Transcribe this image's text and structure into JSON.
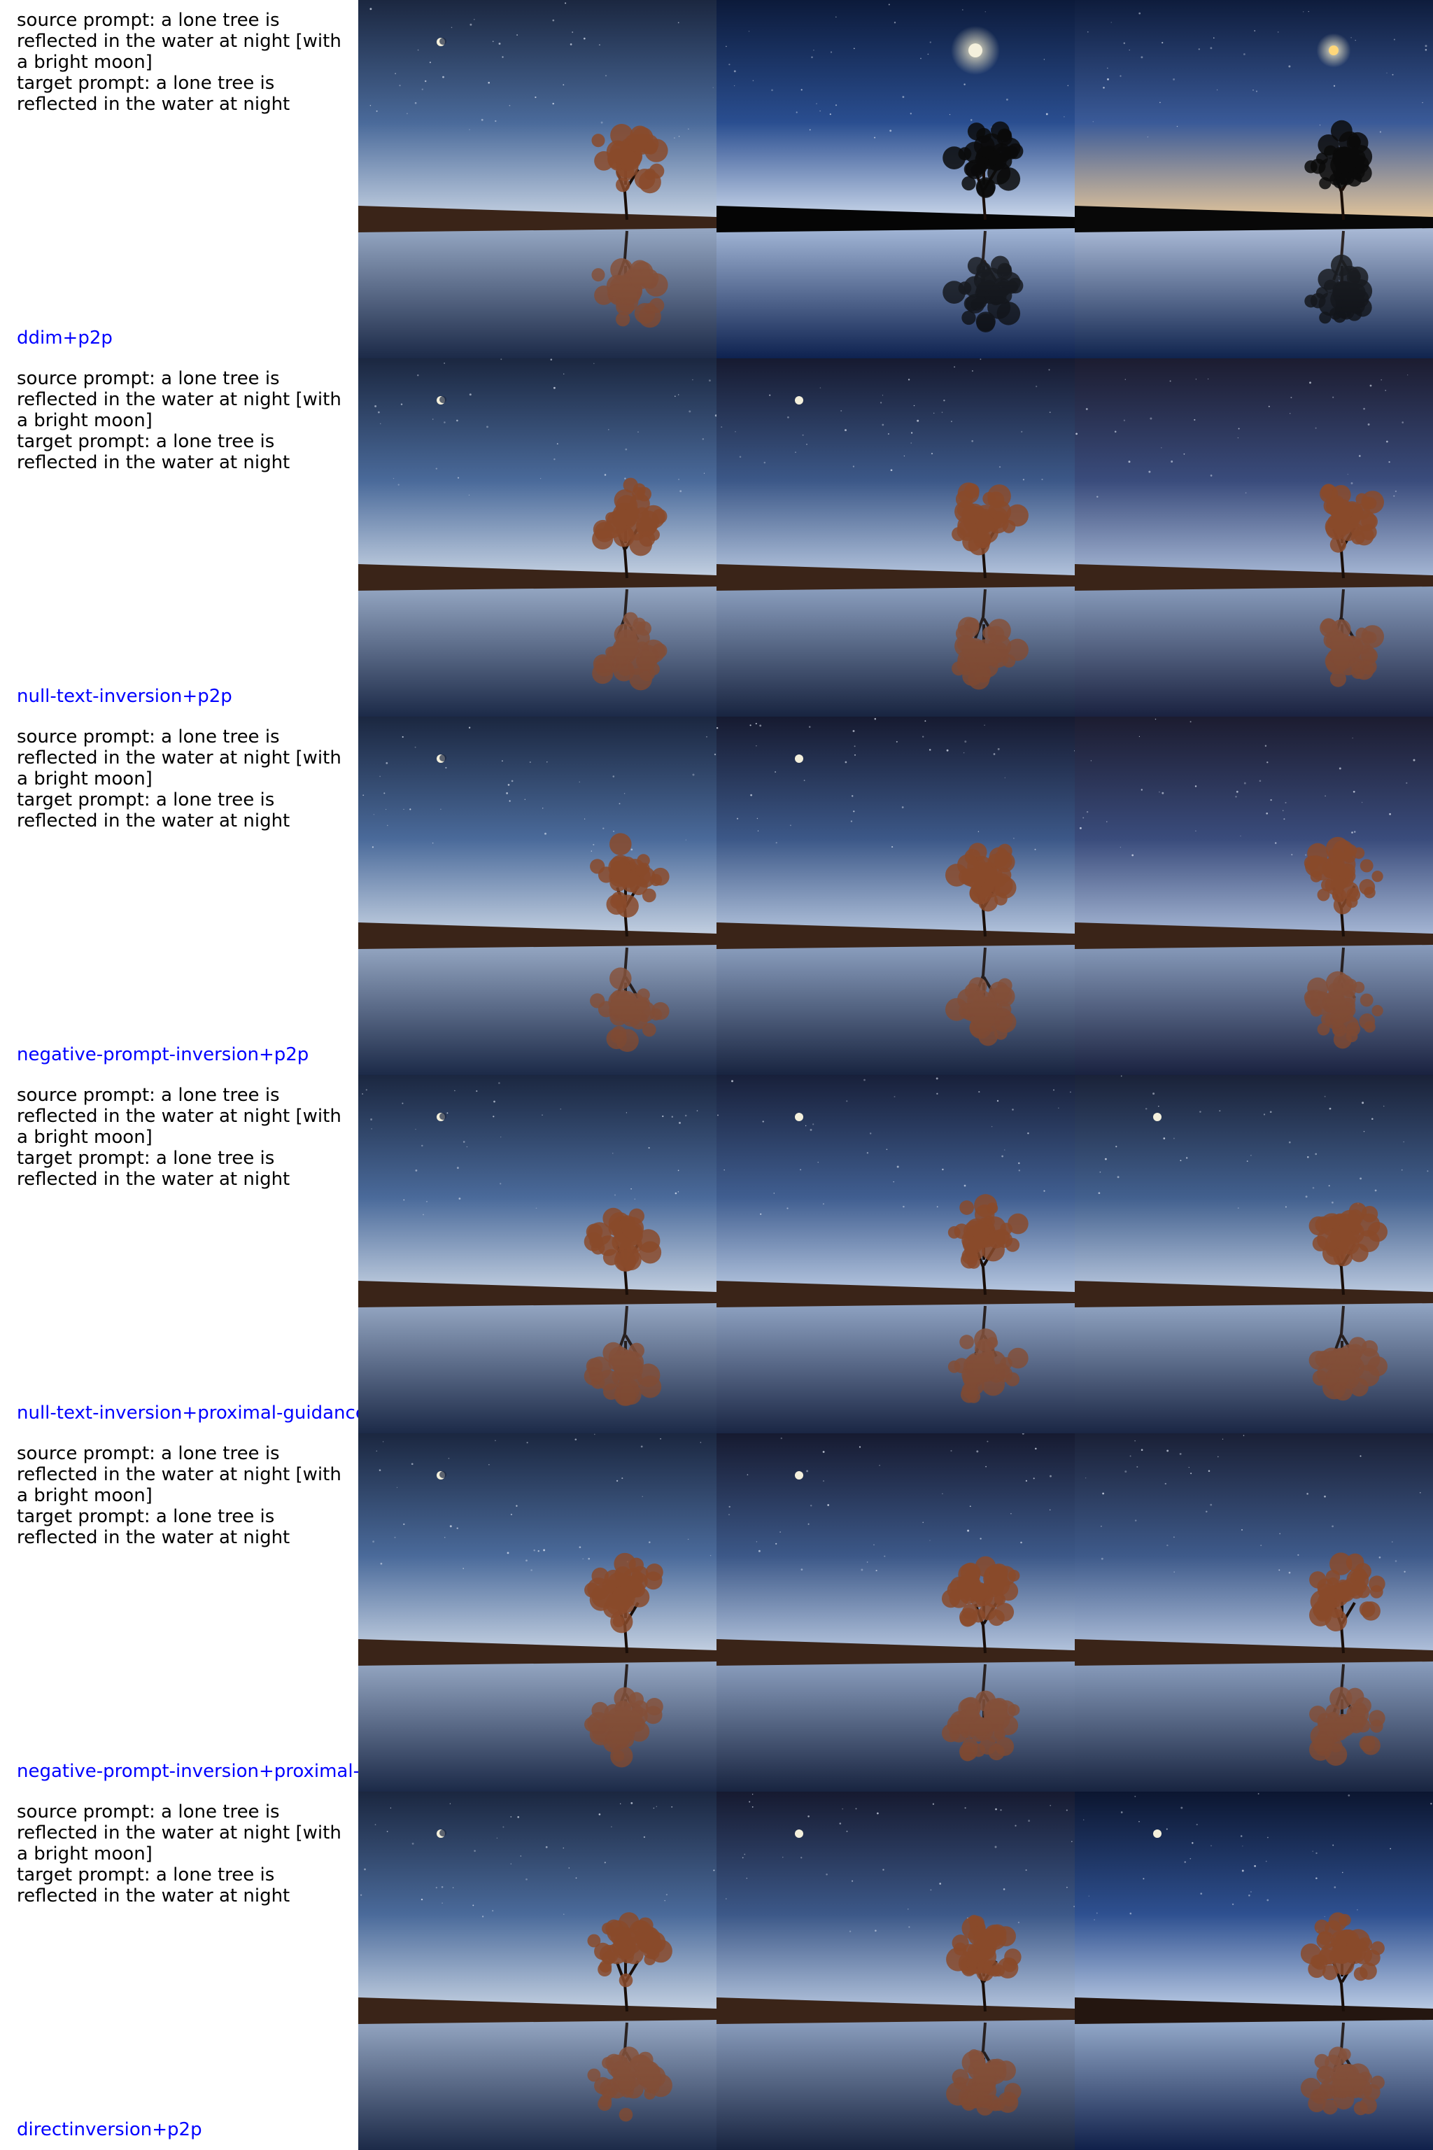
{
  "prompts": {
    "source_prefix": "source prompt: a lone tree is reflected in the water at night [with a bright moon]",
    "target_prefix": "target prompt: a lone tree is reflected in the water at night"
  },
  "rows": [
    {
      "method": "ddim+p2p",
      "images": [
        {
          "moon": "crescent",
          "moon_glow": false,
          "top": "#1b2740",
          "mid": "#4a6a9a",
          "horizon": "#c8d4e4",
          "tree": "#8a4a2a",
          "shore": "#3a2418",
          "water": "#9aacc8",
          "water_dark": "#1c2a48"
        },
        {
          "moon": "full",
          "moon_glow": true,
          "top": "#0c1a3a",
          "mid": "#2a4e90",
          "horizon": "#d0dcee",
          "tree": "#0a0a0a",
          "shore": "#050505",
          "water": "#a8bcdc",
          "water_dark": "#0e2250"
        },
        {
          "moon": "bright",
          "moon_glow": true,
          "top": "#0e1c3c",
          "mid": "#3a5a98",
          "horizon": "#e8c89a",
          "tree": "#0a0a0a",
          "shore": "#080808",
          "water": "#b0c0dc",
          "water_dark": "#10244e"
        }
      ]
    },
    {
      "method": "null-text-inversion+p2p",
      "images": [
        {
          "moon": "crescent",
          "moon_glow": false,
          "top": "#1b2740",
          "mid": "#4a6a9a",
          "horizon": "#c8d4e4",
          "tree": "#8a4a2a",
          "shore": "#3a2418",
          "water": "#9aacc8",
          "water_dark": "#1c2a48"
        },
        {
          "moon": "small",
          "moon_glow": false,
          "top": "#161a30",
          "mid": "#3c5888",
          "horizon": "#b8c8e0",
          "tree": "#8a4a2a",
          "shore": "#3a2418",
          "water": "#90a4c4",
          "water_dark": "#182440"
        },
        {
          "moon": "none",
          "moon_glow": false,
          "top": "#1c1c30",
          "mid": "#3a4c7c",
          "horizon": "#aabbd8",
          "tree": "#8a4a2a",
          "shore": "#3a2418",
          "water": "#8ca0c0",
          "water_dark": "#1a2240"
        }
      ]
    },
    {
      "method": "negative-prompt-inversion+p2p",
      "images": [
        {
          "moon": "crescent",
          "moon_glow": false,
          "top": "#1b2740",
          "mid": "#4a6a9a",
          "horizon": "#c8d4e4",
          "tree": "#8a4a2a",
          "shore": "#3a2418",
          "water": "#9aacc8",
          "water_dark": "#1c2a48"
        },
        {
          "moon": "small",
          "moon_glow": false,
          "top": "#161a30",
          "mid": "#3c5888",
          "horizon": "#b8c8e0",
          "tree": "#8a4a2a",
          "shore": "#3a2418",
          "water": "#90a4c4",
          "water_dark": "#182440"
        },
        {
          "moon": "none",
          "moon_glow": false,
          "top": "#1c1c30",
          "mid": "#3a4c7c",
          "horizon": "#aabbd8",
          "tree": "#8a4a2a",
          "shore": "#3a2418",
          "water": "#8ca0c0",
          "water_dark": "#1a2240"
        }
      ]
    },
    {
      "method": "null-text-inversion+proximal-guidance",
      "images": [
        {
          "moon": "crescent",
          "moon_glow": false,
          "top": "#1b2740",
          "mid": "#4a6a9a",
          "horizon": "#c8d4e4",
          "tree": "#8a4a2a",
          "shore": "#3a2418",
          "water": "#9aacc8",
          "water_dark": "#1c2a48"
        },
        {
          "moon": "small",
          "moon_glow": false,
          "top": "#18203a",
          "mid": "#405e90",
          "horizon": "#bccce4",
          "tree": "#8a4a2a",
          "shore": "#3a2418",
          "water": "#94a8c8",
          "water_dark": "#1a2644"
        },
        {
          "moon": "small",
          "moon_glow": false,
          "top": "#1a2238",
          "mid": "#42608e",
          "horizon": "#bfcde2",
          "tree": "#8a4a2a",
          "shore": "#3a2418",
          "water": "#96aac8",
          "water_dark": "#1a2644"
        }
      ]
    },
    {
      "method": "negative-prompt-inversion+proximal-guidance",
      "images": [
        {
          "moon": "crescent",
          "moon_glow": false,
          "top": "#1b2740",
          "mid": "#4a6a9a",
          "horizon": "#c8d4e4",
          "tree": "#8a4a2a",
          "shore": "#3a2418",
          "water": "#9aacc8",
          "water_dark": "#1c2a48"
        },
        {
          "moon": "small",
          "moon_glow": false,
          "top": "#161a30",
          "mid": "#3c5888",
          "horizon": "#b8c8e0",
          "tree": "#8a4a2a",
          "shore": "#3a2418",
          "water": "#90a4c4",
          "water_dark": "#182440"
        },
        {
          "moon": "none",
          "moon_glow": false,
          "top": "#1a2036",
          "mid": "#3e5a8a",
          "horizon": "#b4c4de",
          "tree": "#8a4a2a",
          "shore": "#3a2418",
          "water": "#8ea2c2",
          "water_dark": "#182440"
        }
      ]
    },
    {
      "method": "directinversion+p2p",
      "images": [
        {
          "moon": "crescent",
          "moon_glow": false,
          "top": "#1b2740",
          "mid": "#4a6a9a",
          "horizon": "#c8d4e4",
          "tree": "#8a4a2a",
          "shore": "#3a2418",
          "water": "#9aacc8",
          "water_dark": "#1c2a48"
        },
        {
          "moon": "small",
          "moon_glow": false,
          "top": "#161a30",
          "mid": "#3c5888",
          "horizon": "#b8c8e0",
          "tree": "#8a4a2a",
          "shore": "#3a2418",
          "water": "#90a4c4",
          "water_dark": "#182440"
        },
        {
          "moon": "small",
          "moon_glow": false,
          "top": "#0c1630",
          "mid": "#2e5090",
          "horizon": "#c0d0e8",
          "tree": "#8a4a2a",
          "shore": "#241610",
          "water": "#9ab0d0",
          "water_dark": "#10204a"
        }
      ]
    }
  ]
}
